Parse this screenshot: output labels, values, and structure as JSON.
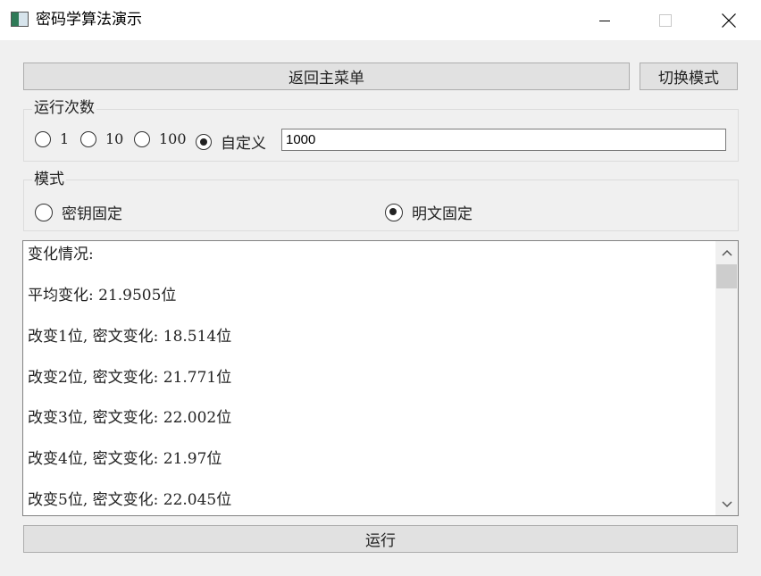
{
  "window": {
    "title": "密码学算法演示"
  },
  "toolbar": {
    "back_label": "返回主菜单",
    "switch_label": "切换模式"
  },
  "run_count": {
    "group_title": "运行次数",
    "options": [
      {
        "label": "1",
        "checked": false
      },
      {
        "label": "10",
        "checked": false
      },
      {
        "label": "100",
        "checked": false
      },
      {
        "label": "自定义",
        "checked": true
      }
    ],
    "custom_value": "1000"
  },
  "mode": {
    "group_title": "模式",
    "options": [
      {
        "label": "密钥固定",
        "checked": false
      },
      {
        "label": "明文固定",
        "checked": true
      }
    ]
  },
  "output": {
    "lines": [
      "变化情况:",
      "平均变化: 21.9505位",
      "改变1位, 密文变化: 18.514位",
      "改变2位, 密文变化: 21.771位",
      "改变3位, 密文变化: 22.002位",
      "改变4位, 密文变化: 21.97位",
      "改变5位, 密文变化: 22.045位"
    ]
  },
  "run_button": {
    "label": "运行"
  }
}
